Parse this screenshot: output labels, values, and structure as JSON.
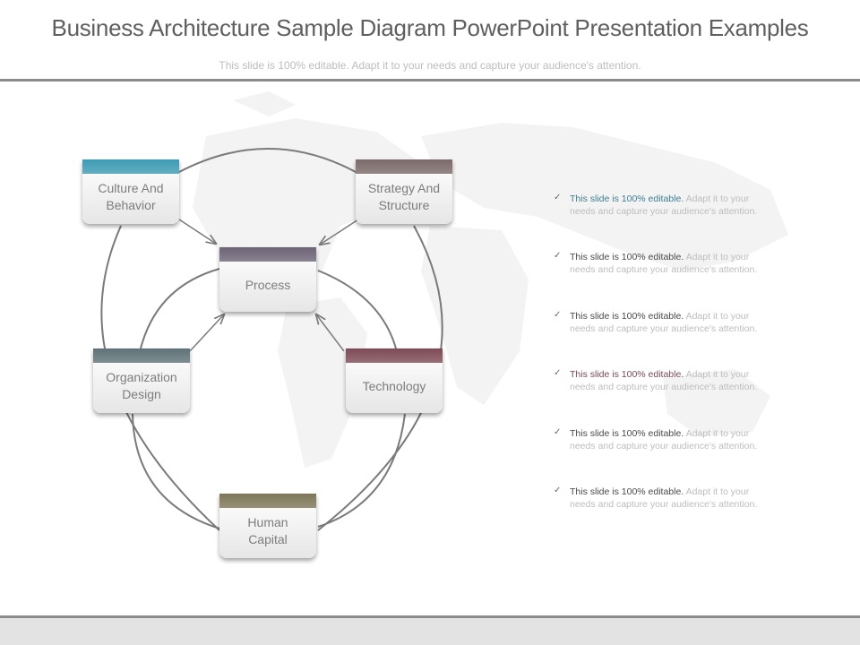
{
  "title": "Business Architecture Sample Diagram PowerPoint Presentation Examples",
  "subtitle": "This slide is 100% editable. Adapt it to your needs and capture your audience's attention.",
  "nodes": [
    {
      "id": "culture",
      "label": "Culture And\nBehavior",
      "color": "#3d9bb3"
    },
    {
      "id": "strategy",
      "label": "Strategy And\nStructure",
      "color": "#7b6a69"
    },
    {
      "id": "process",
      "label": "Process",
      "color": "#6d6476"
    },
    {
      "id": "organization",
      "label": "Organization\nDesign",
      "color": "#5f7277"
    },
    {
      "id": "technology",
      "label": "Technology",
      "color": "#7d4a55"
    },
    {
      "id": "human",
      "label": "Human\nCapital",
      "color": "#7d7659"
    }
  ],
  "bullets": [
    {
      "lead": "This slide is 100% editable.",
      "rest": " Adapt it to your needs and capture your audience's attention.",
      "lead_color": "#3d7f91"
    },
    {
      "lead": "This slide is 100% editable.",
      "rest": " Adapt it to your needs and capture your audience's attention.",
      "lead_color": "#4a4a4a"
    },
    {
      "lead": "This slide is 100% editable.",
      "rest": " Adapt it to your needs and capture your audience's attention.",
      "lead_color": "#4a4a4a"
    },
    {
      "lead": "This slide is 100% editable.",
      "rest": " Adapt it to your needs and capture your audience's attention.",
      "lead_color": "#7d4a55"
    },
    {
      "lead": "This slide is 100% editable.",
      "rest": " Adapt it to your needs and capture your audience's attention.",
      "lead_color": "#4a4a4a"
    },
    {
      "lead": "This slide is 100% editable.",
      "rest": " Adapt it to your needs and capture your audience's attention.",
      "lead_color": "#4a4a4a"
    }
  ],
  "check_glyph": "✓"
}
